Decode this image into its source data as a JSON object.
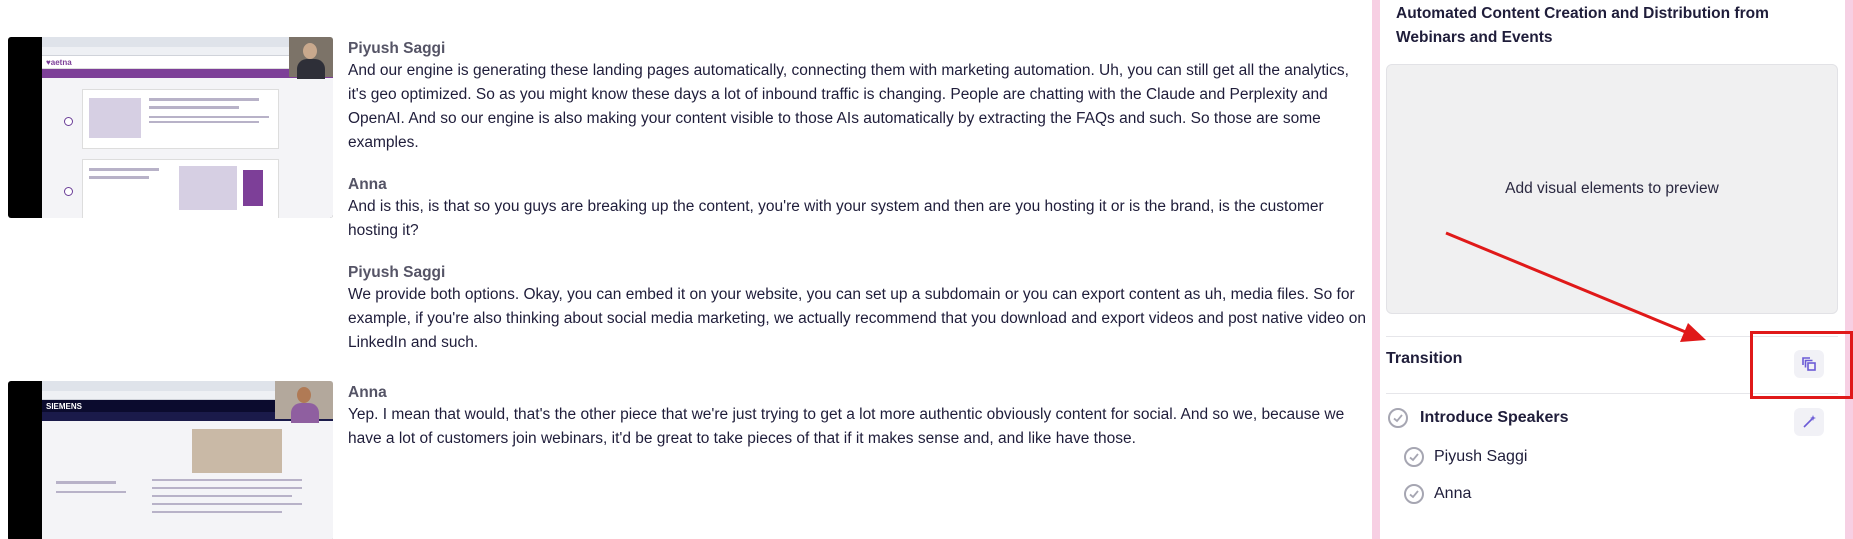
{
  "transcript": {
    "entries": [
      {
        "speaker": "Piyush Saggi",
        "text": "And our engine is generating these landing pages automatically, connecting them with marketing automation. Uh, you can still get all the analytics, it's geo optimized. So as you might know these days a lot of inbound traffic is changing. People are chatting with the Claude and Perplexity and OpenAI. And so our engine is also making your content visible to those AIs automatically by extracting the FAQs and such. So those are some examples."
      },
      {
        "speaker": "Anna",
        "text": "And is this, is that so you guys are breaking up the content, you're with your system and then are you hosting it or is the brand, is the customer hosting it?"
      },
      {
        "speaker": "Piyush Saggi",
        "text": "We provide both options. Okay, you can embed it on your website, you can set up a subdomain or you can export content as uh, media files. So for example, if you're also thinking about social media marketing, we actually recommend that you download and export videos and post native video on LinkedIn and such."
      },
      {
        "speaker": "Anna",
        "text": "Yep. I mean that would, that's the other piece that we're just trying to get a lot more authentic obviously content for social. And so we, because we have a lot of customers join webinars, it'd be great to take pieces of that if it makes sense and, and like have those."
      }
    ],
    "thumbnails": [
      {
        "brand": "♥aetna"
      },
      {
        "brand": "SIEMENS"
      }
    ]
  },
  "panel": {
    "title": "Automated Content Creation and Distribution from Webinars and Events",
    "preview_placeholder": "Add visual elements to preview",
    "transition_label": "Transition",
    "section": {
      "title": "Introduce Speakers",
      "items": [
        "Piyush Saggi",
        "Anna"
      ]
    }
  },
  "icons": {
    "transition_button": "layers-copy-icon",
    "section_button": "magic-wand-icon",
    "check": "check-circle-icon"
  },
  "colors": {
    "accent": "#6b5bd6",
    "annotation_red": "#e01919",
    "panel_border": "#f7cfe3"
  }
}
